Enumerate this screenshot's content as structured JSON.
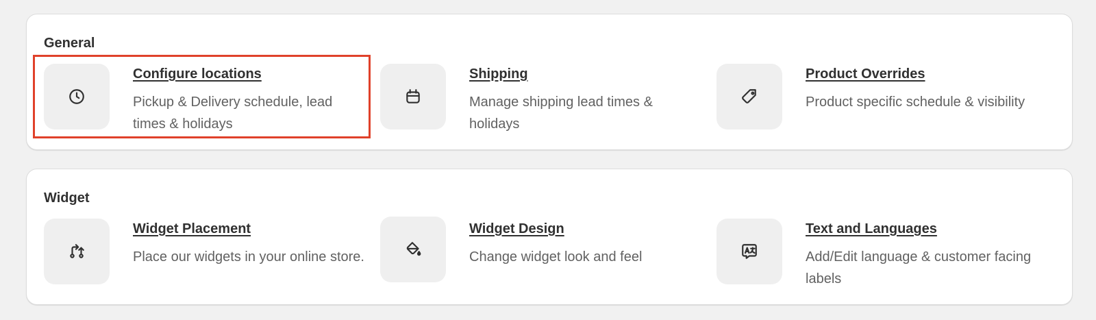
{
  "sections": [
    {
      "title": "General",
      "items": [
        {
          "title": "Configure locations",
          "desc": "Pickup & Delivery schedule, lead times & holidays",
          "icon": "clock-icon"
        },
        {
          "title": "Shipping",
          "desc": "Manage shipping lead times & holidays",
          "icon": "calendar-icon"
        },
        {
          "title": "Product Overrides",
          "desc": "Product specific schedule & visibility",
          "icon": "tag-icon"
        }
      ]
    },
    {
      "title": "Widget",
      "items": [
        {
          "title": "Widget Placement",
          "desc": "Place our widgets in your online store.",
          "icon": "arrows-swap-icon"
        },
        {
          "title": "Widget Design",
          "desc": "Change widget look and feel",
          "icon": "paint-bucket-icon"
        },
        {
          "title": "Text and Languages",
          "desc": "Add/Edit language & customer facing labels",
          "icon": "translate-icon"
        }
      ]
    }
  ],
  "highlight_color": "#e0412a"
}
